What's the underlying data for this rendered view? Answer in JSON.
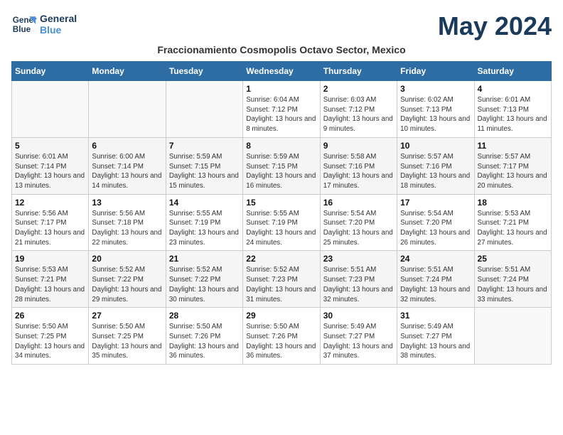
{
  "header": {
    "logo_line1": "General",
    "logo_line2": "Blue",
    "month_title": "May 2024",
    "subtitle": "Fraccionamiento Cosmopolis Octavo Sector, Mexico"
  },
  "days_of_week": [
    "Sunday",
    "Monday",
    "Tuesday",
    "Wednesday",
    "Thursday",
    "Friday",
    "Saturday"
  ],
  "weeks": [
    [
      {
        "day": "",
        "info": ""
      },
      {
        "day": "",
        "info": ""
      },
      {
        "day": "",
        "info": ""
      },
      {
        "day": "1",
        "info": "Sunrise: 6:04 AM\nSunset: 7:12 PM\nDaylight: 13 hours and 8 minutes."
      },
      {
        "day": "2",
        "info": "Sunrise: 6:03 AM\nSunset: 7:12 PM\nDaylight: 13 hours and 9 minutes."
      },
      {
        "day": "3",
        "info": "Sunrise: 6:02 AM\nSunset: 7:13 PM\nDaylight: 13 hours and 10 minutes."
      },
      {
        "day": "4",
        "info": "Sunrise: 6:01 AM\nSunset: 7:13 PM\nDaylight: 13 hours and 11 minutes."
      }
    ],
    [
      {
        "day": "5",
        "info": "Sunrise: 6:01 AM\nSunset: 7:14 PM\nDaylight: 13 hours and 13 minutes."
      },
      {
        "day": "6",
        "info": "Sunrise: 6:00 AM\nSunset: 7:14 PM\nDaylight: 13 hours and 14 minutes."
      },
      {
        "day": "7",
        "info": "Sunrise: 5:59 AM\nSunset: 7:15 PM\nDaylight: 13 hours and 15 minutes."
      },
      {
        "day": "8",
        "info": "Sunrise: 5:59 AM\nSunset: 7:15 PM\nDaylight: 13 hours and 16 minutes."
      },
      {
        "day": "9",
        "info": "Sunrise: 5:58 AM\nSunset: 7:16 PM\nDaylight: 13 hours and 17 minutes."
      },
      {
        "day": "10",
        "info": "Sunrise: 5:57 AM\nSunset: 7:16 PM\nDaylight: 13 hours and 18 minutes."
      },
      {
        "day": "11",
        "info": "Sunrise: 5:57 AM\nSunset: 7:17 PM\nDaylight: 13 hours and 20 minutes."
      }
    ],
    [
      {
        "day": "12",
        "info": "Sunrise: 5:56 AM\nSunset: 7:17 PM\nDaylight: 13 hours and 21 minutes."
      },
      {
        "day": "13",
        "info": "Sunrise: 5:56 AM\nSunset: 7:18 PM\nDaylight: 13 hours and 22 minutes."
      },
      {
        "day": "14",
        "info": "Sunrise: 5:55 AM\nSunset: 7:19 PM\nDaylight: 13 hours and 23 minutes."
      },
      {
        "day": "15",
        "info": "Sunrise: 5:55 AM\nSunset: 7:19 PM\nDaylight: 13 hours and 24 minutes."
      },
      {
        "day": "16",
        "info": "Sunrise: 5:54 AM\nSunset: 7:20 PM\nDaylight: 13 hours and 25 minutes."
      },
      {
        "day": "17",
        "info": "Sunrise: 5:54 AM\nSunset: 7:20 PM\nDaylight: 13 hours and 26 minutes."
      },
      {
        "day": "18",
        "info": "Sunrise: 5:53 AM\nSunset: 7:21 PM\nDaylight: 13 hours and 27 minutes."
      }
    ],
    [
      {
        "day": "19",
        "info": "Sunrise: 5:53 AM\nSunset: 7:21 PM\nDaylight: 13 hours and 28 minutes."
      },
      {
        "day": "20",
        "info": "Sunrise: 5:52 AM\nSunset: 7:22 PM\nDaylight: 13 hours and 29 minutes."
      },
      {
        "day": "21",
        "info": "Sunrise: 5:52 AM\nSunset: 7:22 PM\nDaylight: 13 hours and 30 minutes."
      },
      {
        "day": "22",
        "info": "Sunrise: 5:52 AM\nSunset: 7:23 PM\nDaylight: 13 hours and 31 minutes."
      },
      {
        "day": "23",
        "info": "Sunrise: 5:51 AM\nSunset: 7:23 PM\nDaylight: 13 hours and 32 minutes."
      },
      {
        "day": "24",
        "info": "Sunrise: 5:51 AM\nSunset: 7:24 PM\nDaylight: 13 hours and 32 minutes."
      },
      {
        "day": "25",
        "info": "Sunrise: 5:51 AM\nSunset: 7:24 PM\nDaylight: 13 hours and 33 minutes."
      }
    ],
    [
      {
        "day": "26",
        "info": "Sunrise: 5:50 AM\nSunset: 7:25 PM\nDaylight: 13 hours and 34 minutes."
      },
      {
        "day": "27",
        "info": "Sunrise: 5:50 AM\nSunset: 7:25 PM\nDaylight: 13 hours and 35 minutes."
      },
      {
        "day": "28",
        "info": "Sunrise: 5:50 AM\nSunset: 7:26 PM\nDaylight: 13 hours and 36 minutes."
      },
      {
        "day": "29",
        "info": "Sunrise: 5:50 AM\nSunset: 7:26 PM\nDaylight: 13 hours and 36 minutes."
      },
      {
        "day": "30",
        "info": "Sunrise: 5:49 AM\nSunset: 7:27 PM\nDaylight: 13 hours and 37 minutes."
      },
      {
        "day": "31",
        "info": "Sunrise: 5:49 AM\nSunset: 7:27 PM\nDaylight: 13 hours and 38 minutes."
      },
      {
        "day": "",
        "info": ""
      }
    ]
  ]
}
